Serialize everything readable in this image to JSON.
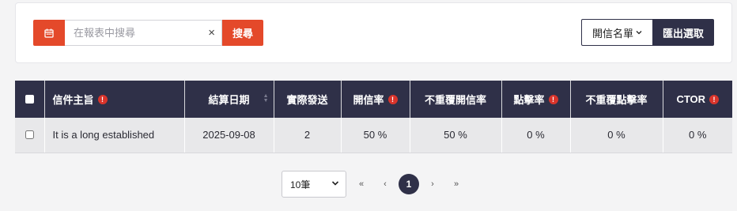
{
  "toolbar": {
    "search_placeholder": "在報表中搜尋",
    "clear_glyph": "×",
    "search_label": "搜尋",
    "list_label": "開信名單",
    "export_label": "匯出選取"
  },
  "table": {
    "columns": [
      {
        "label": "信件主旨",
        "info": true
      },
      {
        "label": "結算日期",
        "sortable": true
      },
      {
        "label": "實際發送"
      },
      {
        "label": "開信率",
        "info": true
      },
      {
        "label": "不重覆開信率"
      },
      {
        "label": "點擊率",
        "info": true
      },
      {
        "label": "不重覆點擊率"
      },
      {
        "label": "CTOR",
        "info": true
      }
    ],
    "rows": [
      [
        "It is a long established",
        "2025-09-08",
        "2",
        "50 %",
        "50 %",
        "0 %",
        "0 %",
        "0 %"
      ]
    ]
  },
  "pagination": {
    "page_size": "10筆",
    "first": "«",
    "prev": "‹",
    "current": "1",
    "next": "›",
    "last": "»"
  },
  "colors": {
    "accent": "#e4492a",
    "header_bg": "#2f3048",
    "info": "#d9342b"
  }
}
